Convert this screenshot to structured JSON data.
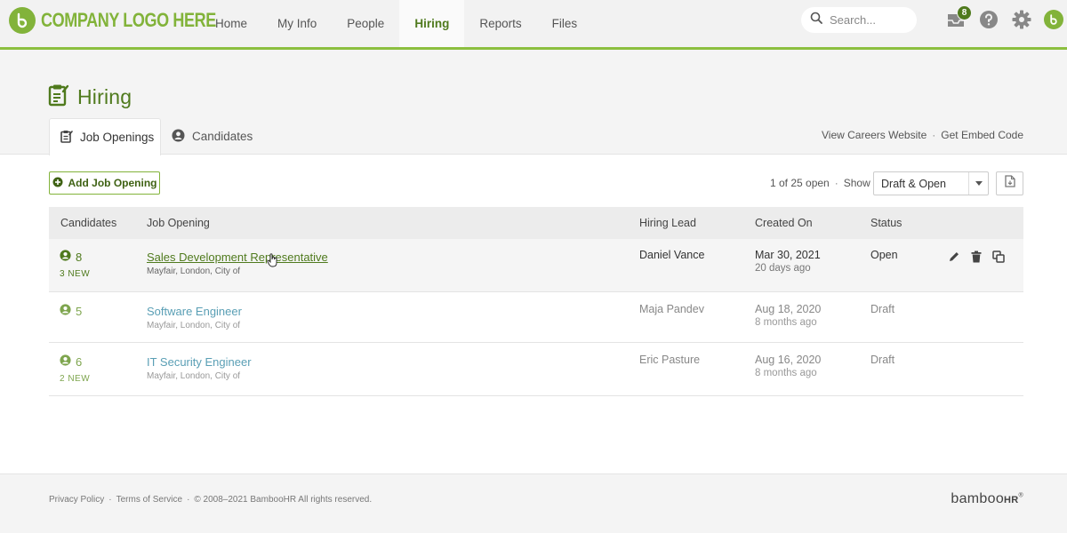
{
  "brand": {
    "logo_text": "COMPANY LOGO HERE",
    "accent": "#82b33a",
    "dark_green": "#4f7a1d"
  },
  "nav": [
    {
      "label": "Home"
    },
    {
      "label": "My Info"
    },
    {
      "label": "People"
    },
    {
      "label": "Hiring",
      "active": true
    },
    {
      "label": "Reports"
    },
    {
      "label": "Files"
    }
  ],
  "search": {
    "placeholder": "Search..."
  },
  "top_icons": {
    "inbox_badge": "8",
    "inbox_icon": "inbox-icon",
    "help_icon": "help-icon",
    "settings_icon": "gear-icon",
    "profile_icon": "bamboo-logo-icon"
  },
  "page": {
    "title": "Hiring",
    "title_icon": "hiring-clipboard-icon"
  },
  "tabs": [
    {
      "label": "Job Openings",
      "active": true
    },
    {
      "label": "Candidates",
      "active": false
    }
  ],
  "header_links": {
    "careers": "View Careers Website",
    "separator": "·",
    "embed": "Get Embed Code"
  },
  "toolbar": {
    "add_label": "Add Job Opening",
    "open_count": "1 of 25 open",
    "separator": "·",
    "show_label": "Show",
    "filter_value": "Draft & Open"
  },
  "table": {
    "headers": {
      "candidates": "Candidates",
      "job_opening": "Job Opening",
      "hiring_lead": "Hiring Lead",
      "created_on": "Created On",
      "status": "Status"
    },
    "rows": [
      {
        "count": "8",
        "new": "3 NEW",
        "title": "Sales Development Representative",
        "location": "Mayfair, London, City of",
        "lead": "Daniel Vance",
        "created": "Mar 30, 2021",
        "ago": "20 days ago",
        "status": "Open"
      },
      {
        "count": "5",
        "new": "",
        "title": "Software Engineer",
        "location": "Mayfair, London, City of",
        "lead": "Maja Pandev",
        "created": "Aug 18, 2020",
        "ago": "8 months ago",
        "status": "Draft"
      },
      {
        "count": "6",
        "new": "2 NEW",
        "title": "IT Security Engineer",
        "location": "Mayfair, London, City of",
        "lead": "Eric Pasture",
        "created": "Aug 16, 2020",
        "ago": "8 months ago",
        "status": "Draft"
      }
    ]
  },
  "footer": {
    "privacy": "Privacy Policy",
    "sep": "·",
    "terms": "Terms of Service",
    "copyright": "© 2008–2021 BambooHR All rights reserved.",
    "brand_main": "bamboo",
    "brand_hr": "HR",
    "brand_mark": "®"
  }
}
